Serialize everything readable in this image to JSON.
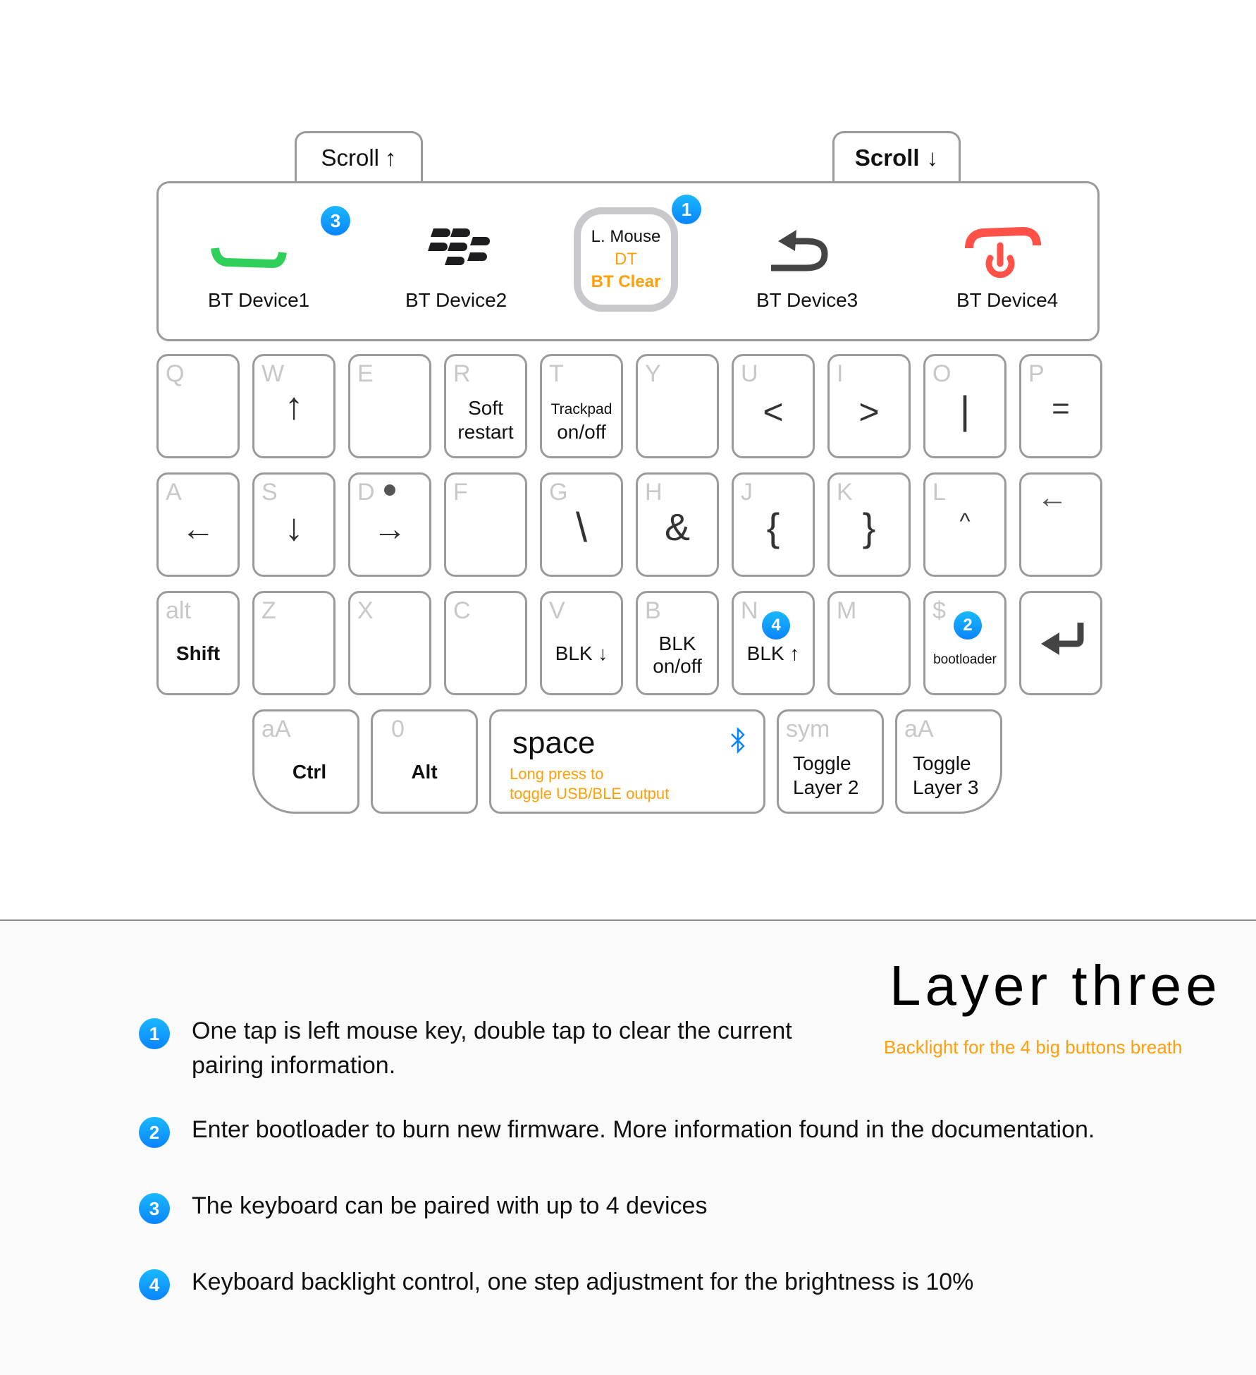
{
  "colors": {
    "badge_blue": "#0a84ff",
    "accent_orange": "#ff9f0a",
    "green": "#2fcf5a",
    "red": "#ff5147",
    "bluetooth_blue": "#0a84ff",
    "border_gray": "#9a9a9a",
    "legend_gray": "#c8c8c8"
  },
  "scroll_up": {
    "label": "Scroll",
    "arrow": "↑"
  },
  "scroll_down": {
    "label": "Scroll",
    "arrow": "↓"
  },
  "top_buttons": [
    {
      "label": "BT Device1",
      "icon": "green-call-icon",
      "badge": "3"
    },
    {
      "label": "BT Device2",
      "icon": "blackberry-logo-icon"
    },
    {
      "line1": "L. Mouse",
      "line2": "DT",
      "line3": "BT Clear",
      "icon": "trackpad-icon",
      "badge": "1"
    },
    {
      "label": "BT Device3",
      "icon": "back-arrow-icon"
    },
    {
      "label": "BT Device4",
      "icon": "red-end-call-power-icon"
    }
  ],
  "rows": {
    "row1": [
      {
        "legend": "Q",
        "main": ""
      },
      {
        "legend": "W",
        "main": "↑"
      },
      {
        "legend": "E",
        "main": ""
      },
      {
        "legend": "R",
        "main1": "Soft",
        "main2": "restart"
      },
      {
        "legend": "T",
        "main1": "Trackpad",
        "main2": "on/off"
      },
      {
        "legend": "Y",
        "main": ""
      },
      {
        "legend": "U",
        "main": "<"
      },
      {
        "legend": "I",
        "main": ">"
      },
      {
        "legend": "O",
        "main": "|"
      },
      {
        "legend": "P",
        "main": "="
      }
    ],
    "row2": [
      {
        "legend": "A",
        "main": "←"
      },
      {
        "legend": "S",
        "main": "↓"
      },
      {
        "legend": "D",
        "main": "→"
      },
      {
        "legend": "F",
        "main": ""
      },
      {
        "legend": "G",
        "main": "\\"
      },
      {
        "legend": "H",
        "main": "&"
      },
      {
        "legend": "J",
        "main": "{"
      },
      {
        "legend": "K",
        "main": "}"
      },
      {
        "legend": "L",
        "main": "^"
      },
      {
        "legend": "",
        "main": "←",
        "name": "backspace"
      }
    ],
    "row3": [
      {
        "legend": "alt",
        "main": "Shift"
      },
      {
        "legend": "Z",
        "main": ""
      },
      {
        "legend": "X",
        "main": ""
      },
      {
        "legend": "C",
        "main": ""
      },
      {
        "legend": "V",
        "main": "BLK ↓"
      },
      {
        "legend": "B",
        "main1": "BLK",
        "main2": "on/off"
      },
      {
        "legend": "N",
        "main": "BLK ↑",
        "badge": "4"
      },
      {
        "legend": "M",
        "main": ""
      },
      {
        "legend": "$",
        "main": "bootloader",
        "badge": "2"
      },
      {
        "legend": "",
        "main": "↵",
        "name": "enter"
      }
    ],
    "row4": {
      "ctrl": {
        "legend": "aA",
        "main": "Ctrl"
      },
      "alt": {
        "legend": "0",
        "main": "Alt"
      },
      "space": {
        "main": "space",
        "sub1": "Long press to",
        "sub2": "toggle USB/BLE output",
        "icon": "bluetooth-icon"
      },
      "sym": {
        "legend": "sym",
        "main1": "Toggle",
        "main2": "Layer 2"
      },
      "aa": {
        "legend": "aA",
        "main1": "Toggle",
        "main2": "Layer 3"
      }
    }
  },
  "layer": {
    "title": "Layer three",
    "subtitle": "Backlight for the 4 big buttons breath"
  },
  "notes": [
    {
      "num": "1",
      "line1": "One tap is left mouse key, double tap to clear the current",
      "line2": "pairing information."
    },
    {
      "num": "2",
      "text": "Enter bootloader to burn new firmware. More information found in the documentation."
    },
    {
      "num": "3",
      "text": "The keyboard can be paired with up to 4 devices"
    },
    {
      "num": "4",
      "text": "Keyboard backlight control, one step adjustment for the brightness is 10%"
    }
  ]
}
